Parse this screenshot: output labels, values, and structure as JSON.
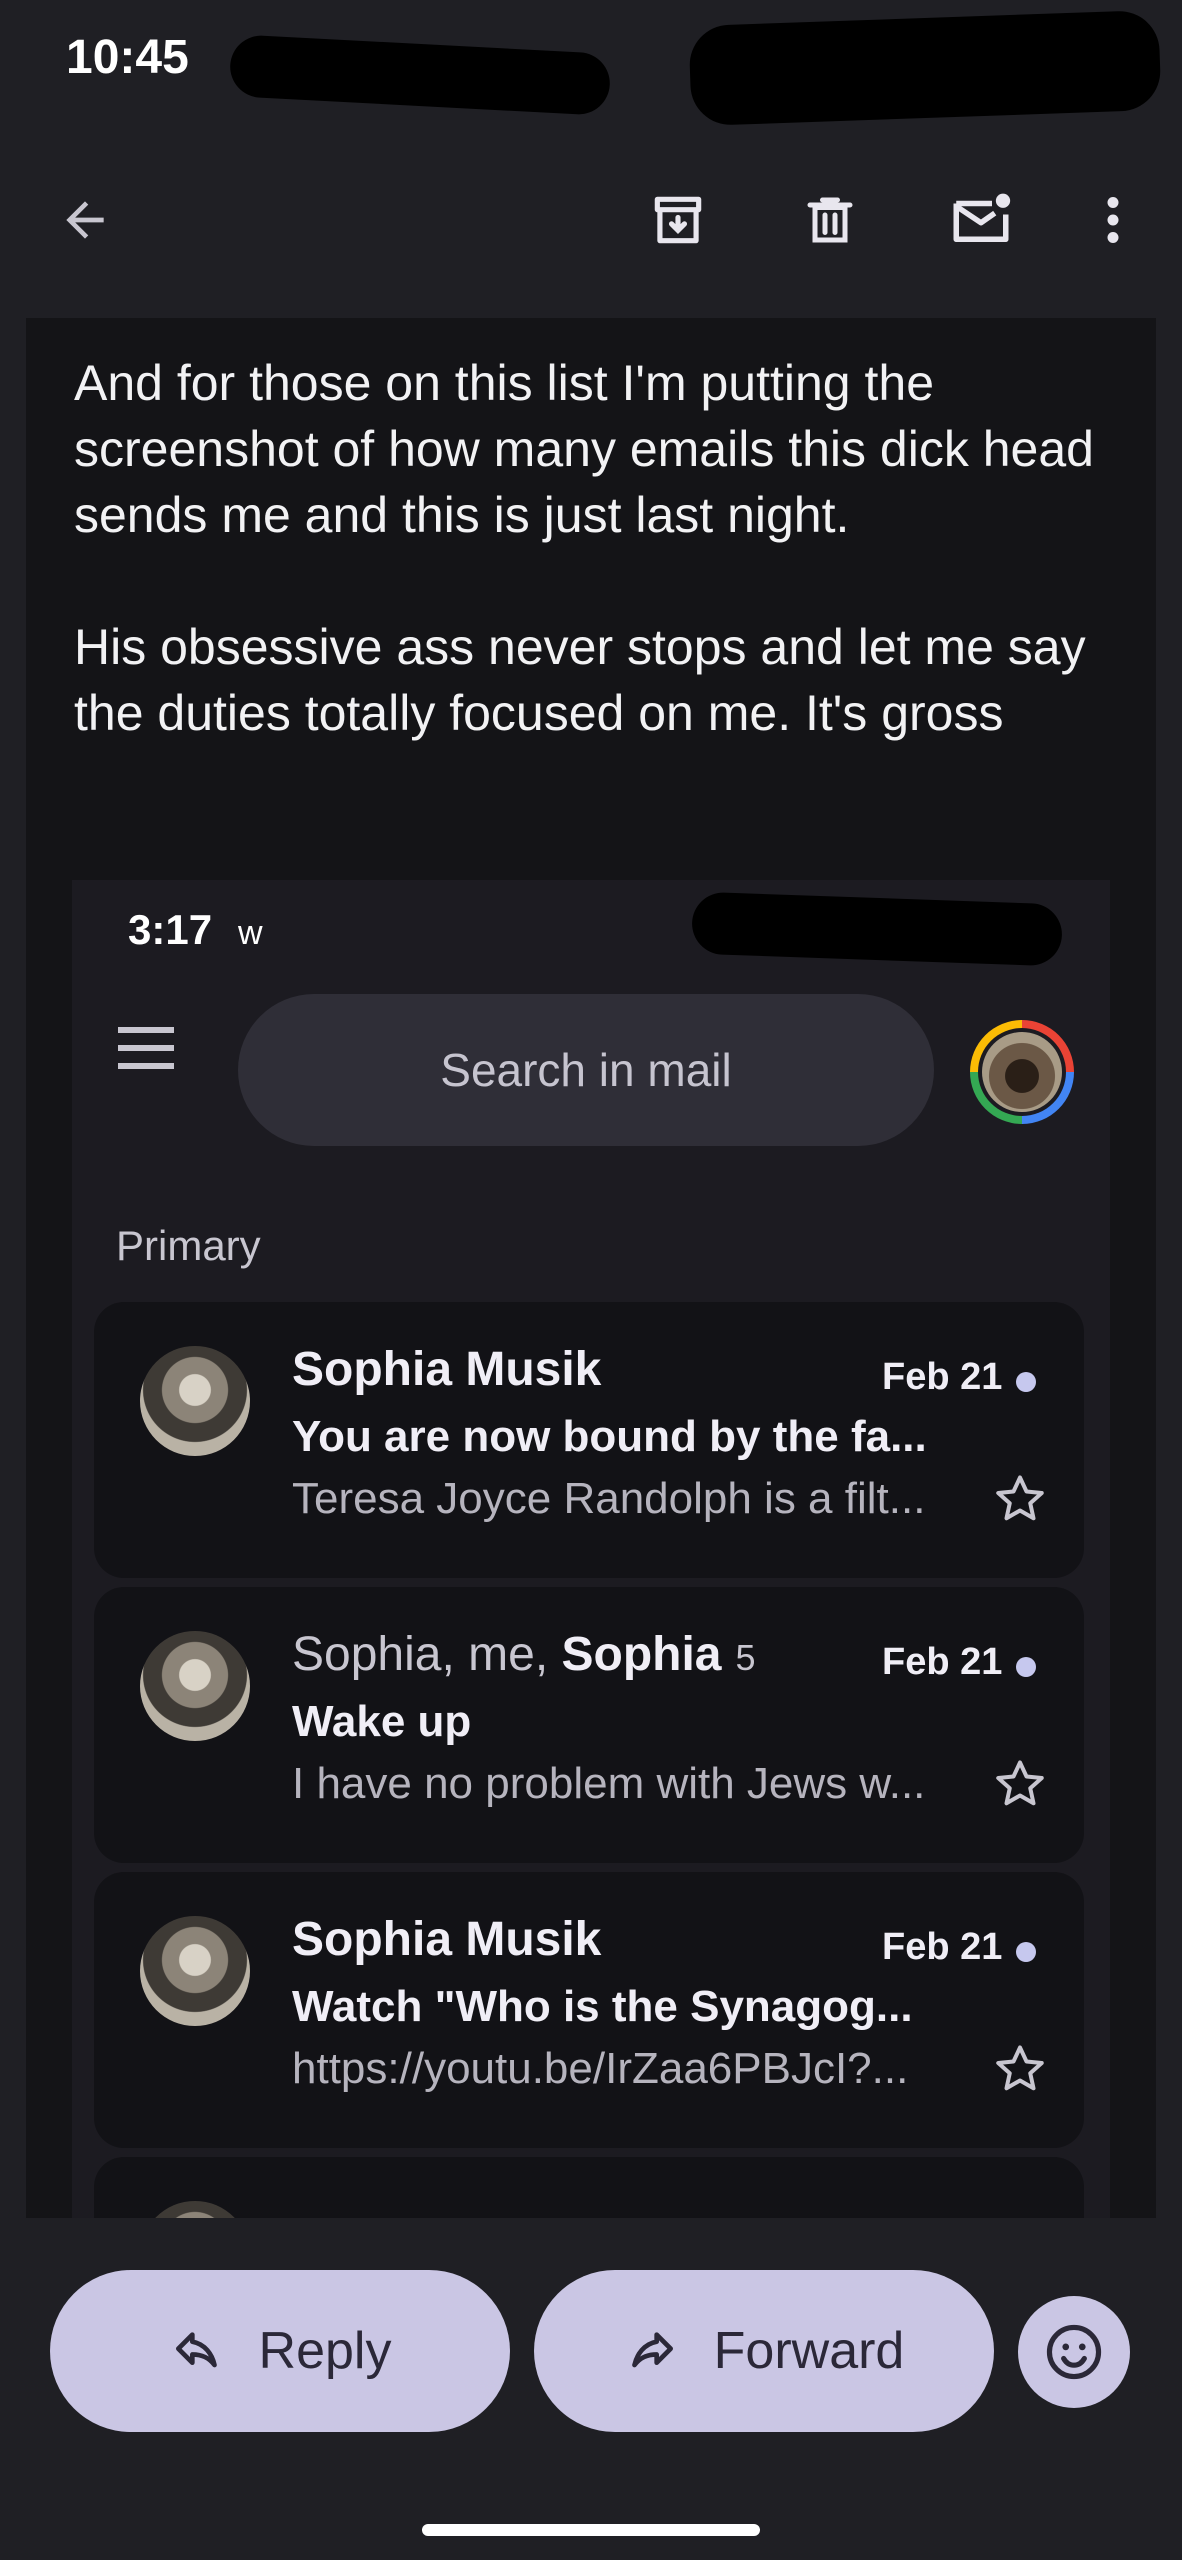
{
  "status_bar": {
    "time": "10:45"
  },
  "top_bar": {
    "icons": [
      "back-arrow-icon",
      "archive-icon",
      "delete-icon",
      "mark-unread-icon",
      "more-options-icon"
    ]
  },
  "message": {
    "paragraph1": "And for those on this list I'm putting the screenshot of how many emails this dick head sends me and this is just last night.",
    "paragraph2": "His obsessive ass never stops and let me say the duties totally focused on me. It's gross"
  },
  "embedded_screenshot": {
    "time": "3:17",
    "status_letter": "w",
    "search_placeholder": "Search in mail",
    "section_label": "Primary",
    "emails": [
      {
        "sender": "Sophia Musik",
        "date": "Feb 21",
        "subject": "You are now bound by the fa...",
        "snippet": "Teresa Joyce Randolph is a filt..."
      },
      {
        "sender_light": "Sophia, me, ",
        "sender_bold": "Sophia",
        "count": "5",
        "date": "Feb 21",
        "subject": "Wake up",
        "snippet": "I have no problem with Jews w..."
      },
      {
        "sender": "Sophia Musik",
        "date": "Feb 21",
        "subject": "Watch \"Who is the Synagog...",
        "snippet": "https://youtu.be/IrZaa6PBJcI?..."
      }
    ]
  },
  "actions": {
    "reply_label": "Reply",
    "forward_label": "Forward"
  },
  "colors": {
    "background": "#1f1f24",
    "message_bg": "#141417",
    "pill_button": "#cac6e4",
    "unread_dot": "#c6c8ee"
  }
}
